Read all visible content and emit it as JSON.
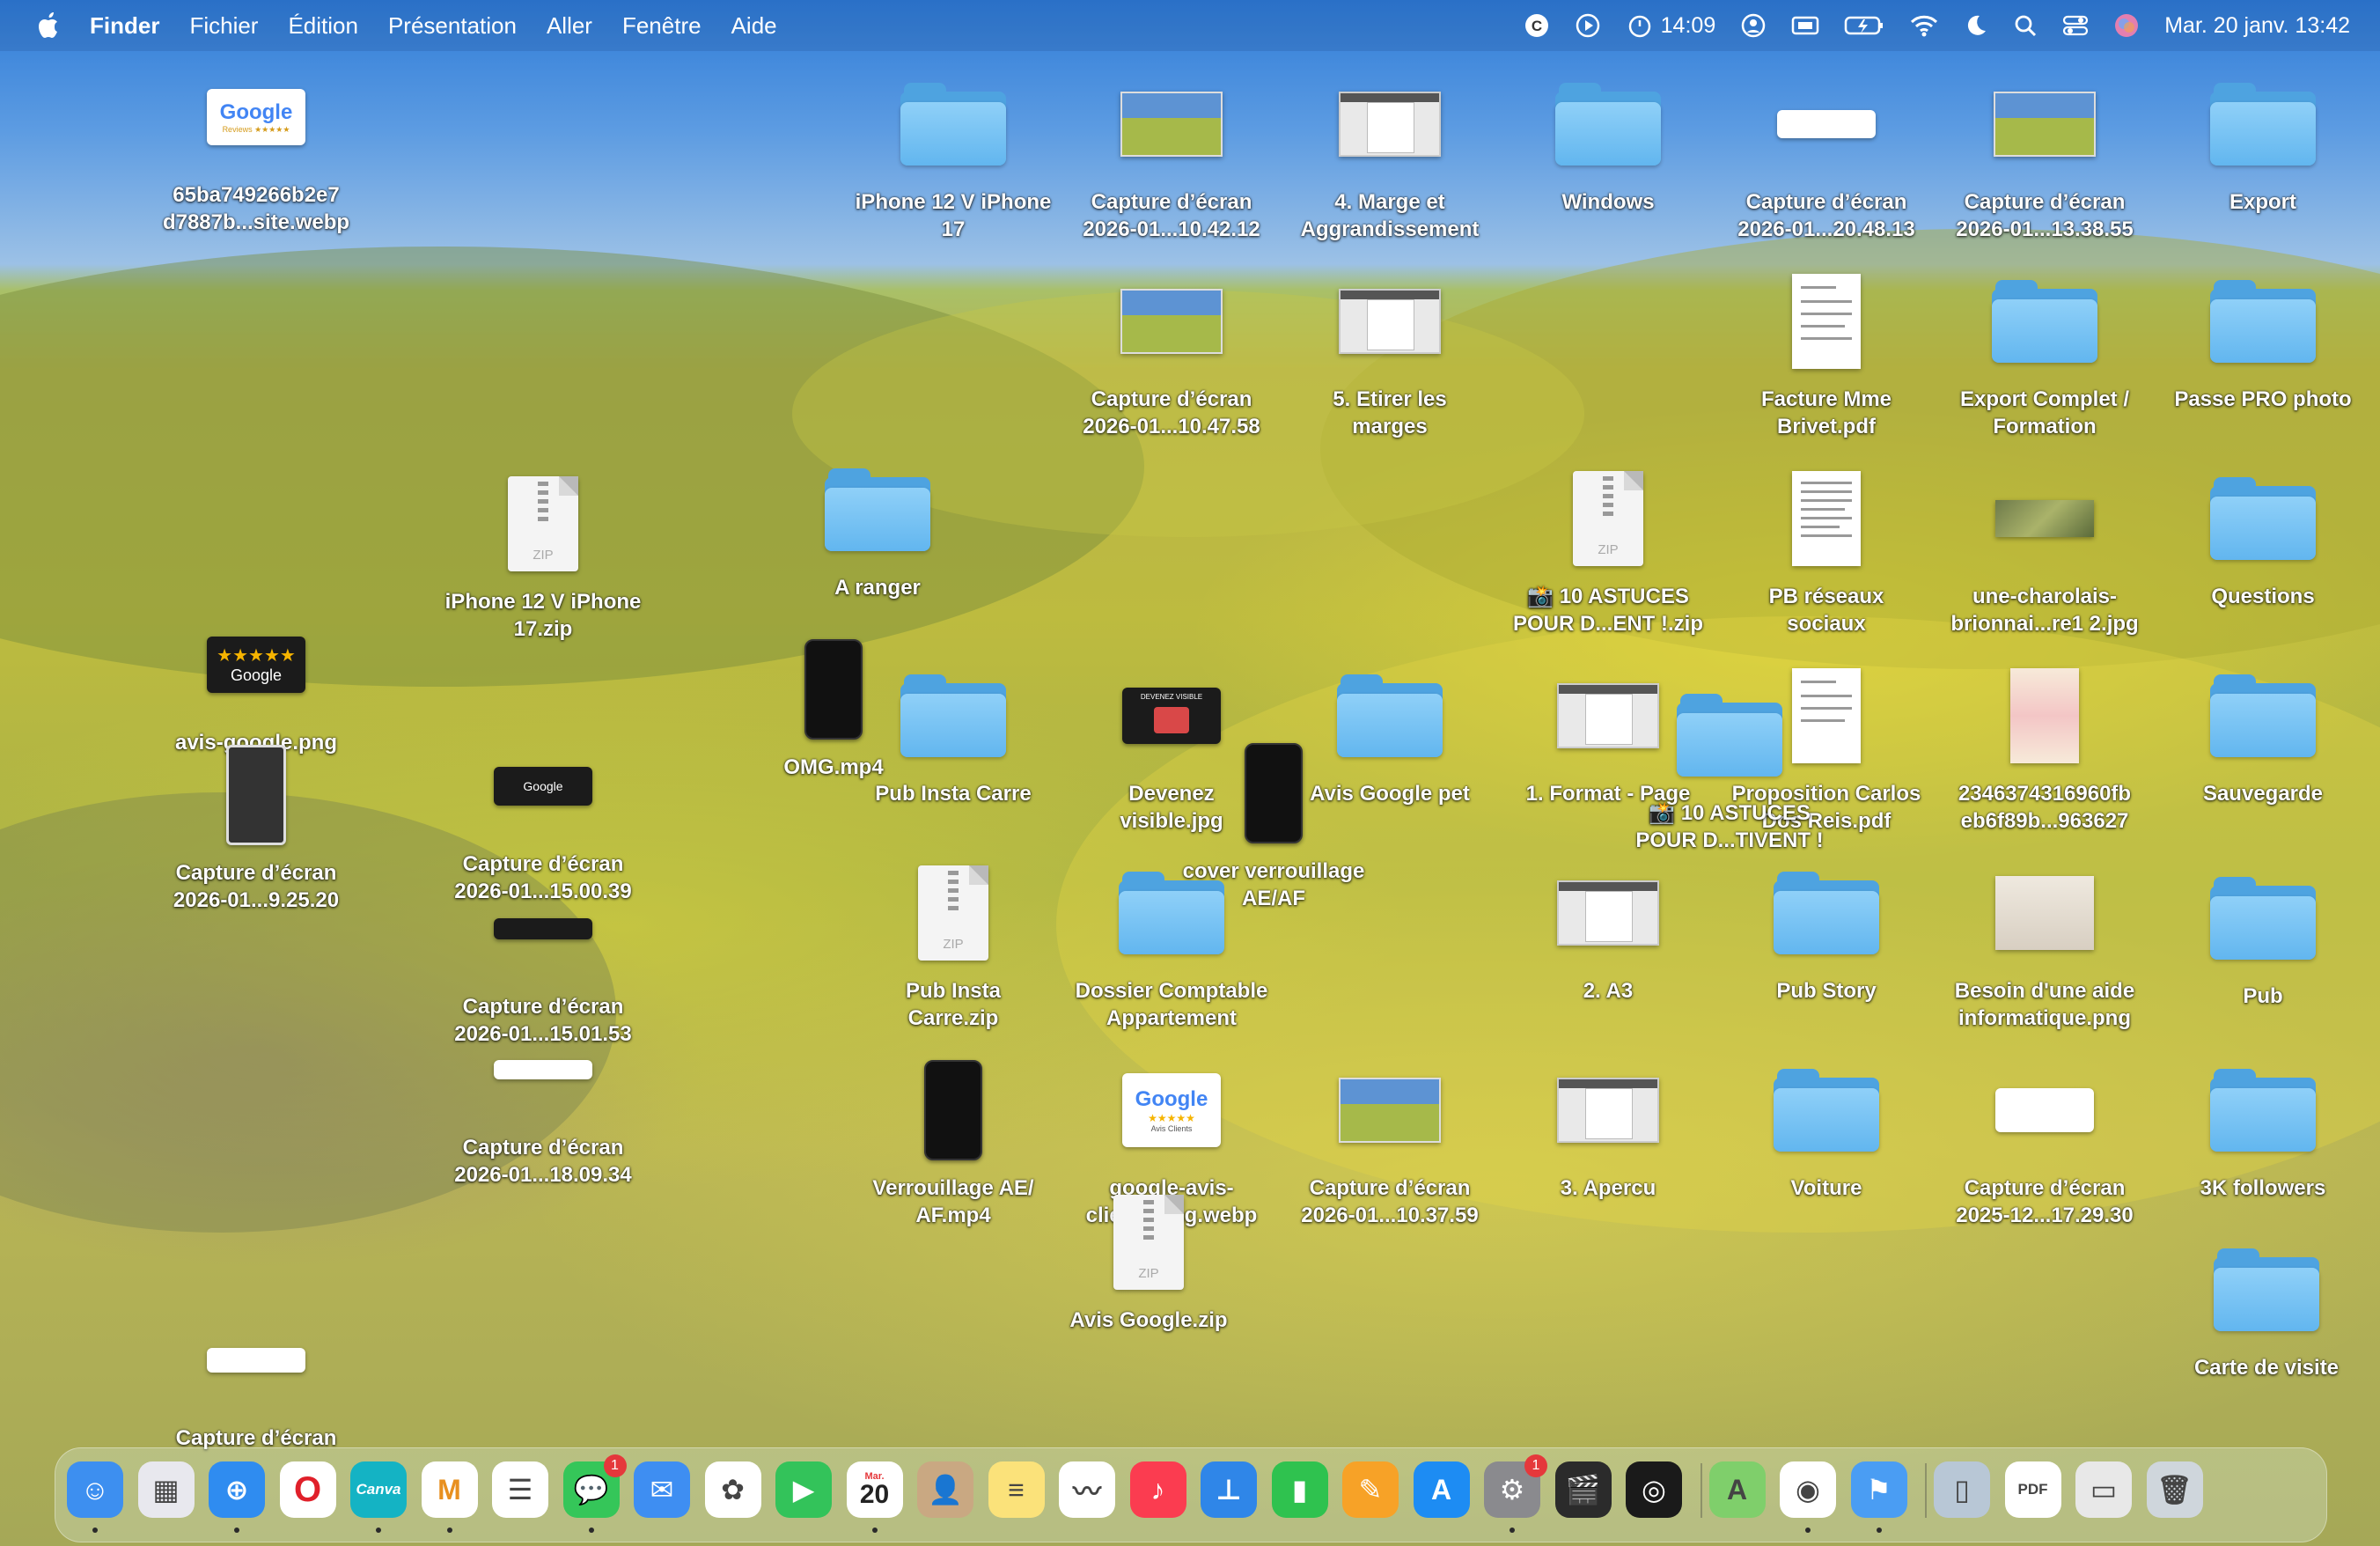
{
  "menubar": {
    "app": "Finder",
    "items": [
      "Fichier",
      "Édition",
      "Présentation",
      "Aller",
      "Fenêtre",
      "Aide"
    ],
    "timer": "14:09",
    "datetime": "Mar. 20 janv.  13:42",
    "status_icons": [
      "c-circle-icon",
      "play-circle-icon",
      "timer-icon",
      "user-circle-icon",
      "display-icon",
      "battery-charging-icon",
      "wifi-icon",
      "moon-icon",
      "search-icon",
      "control-center-icon",
      "siri-icon"
    ]
  },
  "desktop": {
    "icons": [
      {
        "label": "65ba749266b2e7\nd7887b...site.webp",
        "kind": "google-card"
      },
      {
        "label": "iPhone 12 V iPhone\n17",
        "kind": "folder"
      },
      {
        "label": "Capture d’écran\n2026-01...10.42.12",
        "kind": "screenshot"
      },
      {
        "label": "4. Marge et\nAggrandissement",
        "kind": "window-shot"
      },
      {
        "label": "Windows",
        "kind": "folder"
      },
      {
        "label": "Capture d’écran\n2026-01...20.48.13",
        "kind": "white-card"
      },
      {
        "label": "Capture d’écran\n2026-01...13.38.55",
        "kind": "screenshot"
      },
      {
        "label": "Export",
        "kind": "folder"
      },
      {
        "label": "Capture d’écran\n2026-01...10.47.58",
        "kind": "screenshot"
      },
      {
        "label": "5. Etirer les\nmarges",
        "kind": "window-shot"
      },
      {
        "label": "Facture Mme\nBrivet.pdf",
        "kind": "pdf"
      },
      {
        "label": "Export Complet /\nFormation",
        "kind": "folder"
      },
      {
        "label": "Passe PRO photo",
        "kind": "folder"
      },
      {
        "label": "iPhone 12 V iPhone\n17.zip",
        "kind": "zip"
      },
      {
        "label": "A ranger",
        "kind": "folder"
      },
      {
        "label": "📸 10 ASTUCES\nPOUR D...ENT !.zip",
        "kind": "zip"
      },
      {
        "label": "PB réseaux\nsociaux",
        "kind": "pdf"
      },
      {
        "label": "une-charolais-\nbrionnai...re1 2.jpg",
        "kind": "photo"
      },
      {
        "label": "Questions",
        "kind": "folder"
      },
      {
        "label": "avis-google.png",
        "kind": "stars-card"
      },
      {
        "label": "OMG.mp4",
        "kind": "phone"
      },
      {
        "label": "Pub Insta Carre",
        "kind": "folder"
      },
      {
        "label": "Devenez\nvisible.jpg",
        "kind": "dark-card"
      },
      {
        "label": "Avis Google pet",
        "kind": "folder"
      },
      {
        "label": "1. Format - Page",
        "kind": "window-shot"
      },
      {
        "label": "Proposition Carlos\nDos Reis.pdf",
        "kind": "pdf"
      },
      {
        "label": "2346374316960fb\neb6f89b...963627",
        "kind": "poster"
      },
      {
        "label": "Sauvegarde",
        "kind": "folder"
      },
      {
        "label": "📸 10 ASTUCES\nPOUR D...TIVENT !",
        "kind": "folder"
      },
      {
        "label": "Capture d’écran\n2026-01...9.25.20",
        "kind": "book"
      },
      {
        "label": "Capture d’écran\n2026-01...15.00.39",
        "kind": "google-dark"
      },
      {
        "label": "cover verrouillage\nAE/AF",
        "kind": "phone"
      },
      {
        "label": "Pub Insta\nCarre.zip",
        "kind": "zip"
      },
      {
        "label": "Dossier Comptable\nAppartement",
        "kind": "folder"
      },
      {
        "label": "2. A3",
        "kind": "window-shot"
      },
      {
        "label": "Pub Story",
        "kind": "folder"
      },
      {
        "label": "Besoin d'une aide\ninformatique.png",
        "kind": "poster"
      },
      {
        "label": "Pub",
        "kind": "folder"
      },
      {
        "label": "Capture d’écran\n2026-01...15.01.53",
        "kind": "dark-strip"
      },
      {
        "label": "Capture d’écran\n2026-01...18.09.34",
        "kind": "white-strip"
      },
      {
        "label": "Verrouillage AE/\nAF.mp4",
        "kind": "phone"
      },
      {
        "label": "google-avis-\nclients-img.webp",
        "kind": "google-card"
      },
      {
        "label": "Capture d’écran\n2026-01...10.37.59",
        "kind": "screenshot"
      },
      {
        "label": "3. Apercu",
        "kind": "window-shot"
      },
      {
        "label": "Voiture",
        "kind": "folder"
      },
      {
        "label": "Capture d’écran\n2025-12...17.29.30",
        "kind": "white-card"
      },
      {
        "label": "3K followers",
        "kind": "folder"
      },
      {
        "label": "Avis Google.zip",
        "kind": "zip"
      },
      {
        "label": "Carte de visite",
        "kind": "folder"
      },
      {
        "label": "Capture d’écran",
        "kind": "white-strip"
      }
    ]
  },
  "thumbs": {
    "google": "Google",
    "reviews": "Reviews ★★★★★",
    "stars": "★★★★★",
    "zip": "ZIP",
    "avis_clients": "Avis Clients",
    "devenez": "DEVENEZ VISIBLE"
  },
  "dock": {
    "apps": [
      {
        "name": "Finder",
        "icon": "finder-icon",
        "color": "#3d8ff0",
        "glyph": "☺"
      },
      {
        "name": "Launchpad",
        "icon": "launchpad-icon",
        "color": "#e8e8ee",
        "glyph": "▦"
      },
      {
        "name": "Safari",
        "icon": "safari-icon",
        "color": "#2f8cf0",
        "glyph": "⊕"
      },
      {
        "name": "Opera",
        "icon": "opera-icon",
        "color": "#ffffff",
        "glyph": "O"
      },
      {
        "name": "Canva",
        "icon": "canva-icon",
        "color": "#14b3c4",
        "glyph": "Canva"
      },
      {
        "name": "Mastodon-like M",
        "icon": "m-app-icon",
        "color": "#ffffff",
        "glyph": "M"
      },
      {
        "name": "Reminders",
        "icon": "reminders-icon",
        "color": "#ffffff",
        "glyph": "☰"
      },
      {
        "name": "Messages",
        "icon": "messages-icon",
        "color": "#35c659",
        "glyph": "💬",
        "badge": "1"
      },
      {
        "name": "Mail",
        "icon": "mail-icon",
        "color": "#3e8ef2",
        "glyph": "✉"
      },
      {
        "name": "Photos",
        "icon": "photos-icon",
        "color": "#ffffff",
        "glyph": "✿"
      },
      {
        "name": "FaceTime",
        "icon": "facetime-icon",
        "color": "#33c35a",
        "glyph": "▶"
      },
      {
        "name": "Calendar",
        "icon": "calendar-icon",
        "color": "#ffffff",
        "glyph": "20",
        "month": "Mar."
      },
      {
        "name": "Contacts",
        "icon": "contacts-icon",
        "color": "#c9a882",
        "glyph": "👤"
      },
      {
        "name": "Notes",
        "icon": "notes-icon",
        "color": "#fbe27a",
        "glyph": "≡"
      },
      {
        "name": "Freeform",
        "icon": "freeform-icon",
        "color": "#ffffff",
        "glyph": "〰"
      },
      {
        "name": "Music",
        "icon": "music-icon",
        "color": "#fb3c50",
        "glyph": "♪"
      },
      {
        "name": "Keynote",
        "icon": "keynote-icon",
        "color": "#2f86e8",
        "glyph": "⊥"
      },
      {
        "name": "Numbers",
        "icon": "numbers-icon",
        "color": "#2fc24f",
        "glyph": "▮"
      },
      {
        "name": "Pages",
        "icon": "pages-icon",
        "color": "#f7a227",
        "glyph": "✎"
      },
      {
        "name": "App Store",
        "icon": "app-store-icon",
        "color": "#1d8cf3",
        "glyph": "A"
      },
      {
        "name": "System Settings",
        "icon": "settings-icon",
        "color": "#8a8a8e",
        "glyph": "⚙",
        "badge": "1"
      },
      {
        "name": "Final Cut",
        "icon": "claquette-icon",
        "color": "#2b2b2b",
        "glyph": "🎬"
      },
      {
        "name": "Aperture",
        "icon": "aperture-icon",
        "color": "#1a1a1a",
        "glyph": "◎"
      },
      {
        "name": "Maps",
        "icon": "maps-icon",
        "color": "#7fcf6b",
        "glyph": "A"
      },
      {
        "name": "Chrome",
        "icon": "chrome-icon",
        "color": "#ffffff",
        "glyph": "◉"
      },
      {
        "name": "Preview",
        "icon": "preview-icon",
        "color": "#4a9df3",
        "glyph": "⚑"
      },
      {
        "name": "Downloads",
        "icon": "downloads-stack-icon",
        "color": "#b8c7d6",
        "glyph": "▯"
      },
      {
        "name": "Document",
        "icon": "document-stack-icon",
        "color": "#ffffff",
        "glyph": "PDF"
      },
      {
        "name": "Screenshots",
        "icon": "screenshots-stack-icon",
        "color": "#e8e8e8",
        "glyph": "▭"
      },
      {
        "name": "Trash",
        "icon": "trash-icon",
        "color": "#cfd6dc",
        "glyph": "🗑"
      }
    ]
  },
  "colors": {
    "folder": "#62b6ef",
    "menubar_text": "#ffffff",
    "badge": "#e5383b"
  }
}
